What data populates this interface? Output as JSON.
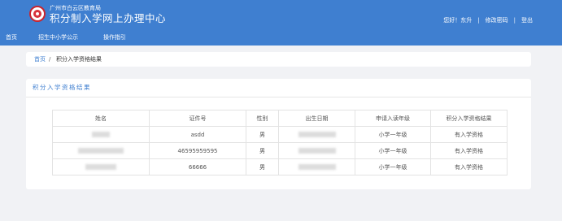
{
  "header": {
    "org_name": "广州市白云区教育局",
    "system_title": "积分制入学网上办理中心",
    "greeting": "您好！东升",
    "change_password": "修改密码",
    "logout": "登出",
    "separator": "|",
    "brand_color": "#3f7fd0"
  },
  "nav": {
    "items": [
      "首页",
      "招生中小学公示",
      "操作指引"
    ]
  },
  "breadcrumb": {
    "home": "首页",
    "separator": "/",
    "current": "积分入学资格结果"
  },
  "panel": {
    "title": "积分入学资格结果"
  },
  "table": {
    "columns": [
      "姓名",
      "证件号",
      "性别",
      "出生日期",
      "申请入读年级",
      "积分入学资格结果"
    ],
    "rows": [
      {
        "name": "",
        "id_number": "asdd",
        "gender": "男",
        "birth_date": "",
        "grade": "小学一年级",
        "result": "有入学资格"
      },
      {
        "name": "",
        "id_number": "46595959595",
        "gender": "男",
        "birth_date": "",
        "grade": "小学一年级",
        "result": "有入学资格"
      },
      {
        "name": "",
        "id_number": "66666",
        "gender": "男",
        "birth_date": "",
        "grade": "小学一年级",
        "result": "有入学资格"
      }
    ]
  }
}
